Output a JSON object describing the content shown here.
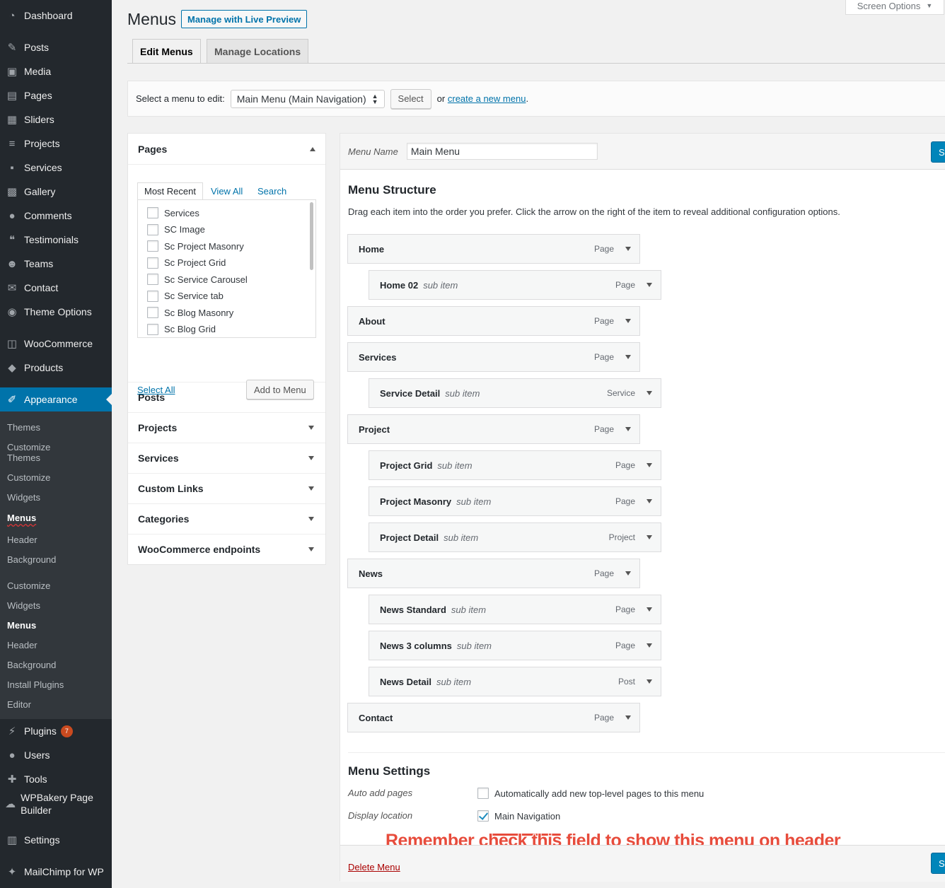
{
  "sidebar": {
    "items": [
      {
        "label": "Dashboard",
        "icon": "dashboard-icon"
      },
      {
        "label": "Posts",
        "icon": "pin-icon"
      },
      {
        "label": "Media",
        "icon": "media-icon"
      },
      {
        "label": "Pages",
        "icon": "pages-icon"
      },
      {
        "label": "Sliders",
        "icon": "sliders-icon"
      },
      {
        "label": "Projects",
        "icon": "projects-icon"
      },
      {
        "label": "Services",
        "icon": "grid-icon"
      },
      {
        "label": "Gallery",
        "icon": "gallery-icon"
      },
      {
        "label": "Comments",
        "icon": "comment-icon"
      },
      {
        "label": "Testimonials",
        "icon": "quote-icon"
      },
      {
        "label": "Teams",
        "icon": "groups-icon"
      },
      {
        "label": "Contact",
        "icon": "mail-icon"
      },
      {
        "label": "Theme Options",
        "icon": "theme-options-icon"
      },
      {
        "label": "WooCommerce",
        "icon": "woo-icon"
      },
      {
        "label": "Products",
        "icon": "box-icon"
      },
      {
        "label": "Appearance",
        "icon": "brush-icon"
      },
      {
        "label": "Plugins",
        "icon": "plugin-icon",
        "badge": "7"
      },
      {
        "label": "Users",
        "icon": "user-icon"
      },
      {
        "label": "Tools",
        "icon": "wrench-icon"
      },
      {
        "label": "WPBakery Page Builder",
        "icon": "wpbakery-icon"
      },
      {
        "label": "Settings",
        "icon": "settings-icon"
      },
      {
        "label": "MailChimp for WP",
        "icon": "mailchimp-icon"
      }
    ],
    "submenu": [
      "Themes",
      "Customize Themes",
      "Customize",
      "Widgets",
      "Menus",
      "Header",
      "Background",
      "Customize",
      "Widgets",
      "Menus",
      "Header",
      "Background",
      "Install Plugins",
      "Editor"
    ]
  },
  "header": {
    "title": "Menus",
    "live_preview": "Manage with Live Preview",
    "screen_options": "Screen Options",
    "tabs": [
      "Edit Menus",
      "Manage Locations"
    ]
  },
  "manage": {
    "label": "Select a menu to edit:",
    "selected": "Main Menu (Main Navigation)",
    "select_button": "Select",
    "or": "or",
    "create_link": "create a new menu",
    "period": "."
  },
  "left": {
    "pages_title": "Pages",
    "subtabs": [
      "Most Recent",
      "View All",
      "Search"
    ],
    "pages": [
      "Services",
      "SC Image",
      "Sc Project Masonry",
      "Sc Project Grid",
      "Sc Service Carousel",
      "Sc Service tab",
      "Sc Blog Masonry",
      "Sc Blog Grid"
    ],
    "select_all": "Select All",
    "add_to_menu": "Add to Menu",
    "sections": [
      "Posts",
      "Projects",
      "Services",
      "Custom Links",
      "Categories",
      "WooCommerce endpoints"
    ]
  },
  "right": {
    "menu_name_label": "Menu Name",
    "menu_name_value": "Main Menu",
    "save_label": "S",
    "structure_title": "Menu Structure",
    "structure_desc": "Drag each item into the order you prefer. Click the arrow on the right of the item to reveal additional configuration options.",
    "sub_item_label": "sub item",
    "items": [
      {
        "title": "Home",
        "type": "Page",
        "depth": 0
      },
      {
        "title": "Home 02",
        "type": "Page",
        "depth": 1
      },
      {
        "title": "About",
        "type": "Page",
        "depth": 0
      },
      {
        "title": "Services",
        "type": "Page",
        "depth": 0
      },
      {
        "title": "Service Detail",
        "type": "Service",
        "depth": 1
      },
      {
        "title": "Project",
        "type": "Page",
        "depth": 0
      },
      {
        "title": "Project Grid",
        "type": "Page",
        "depth": 1
      },
      {
        "title": "Project Masonry",
        "type": "Page",
        "depth": 1
      },
      {
        "title": "Project Detail",
        "type": "Project",
        "depth": 1
      },
      {
        "title": "News",
        "type": "Page",
        "depth": 0
      },
      {
        "title": "News Standard",
        "type": "Page",
        "depth": 1
      },
      {
        "title": "News 3 columns",
        "type": "Page",
        "depth": 1
      },
      {
        "title": "News Detail",
        "type": "Post",
        "depth": 1
      },
      {
        "title": "Contact",
        "type": "Page",
        "depth": 0
      }
    ],
    "settings_title": "Menu Settings",
    "auto_add_label": "Auto add pages",
    "auto_add_text": "Automatically add new top-level pages to this menu",
    "auto_add_checked": false,
    "display_location_label": "Display location",
    "location_text": "Main Navigation",
    "location_checked": true,
    "annotation": "Remember check this field to show this menu on header",
    "delete_menu": "Delete Menu"
  },
  "colors": {
    "accent": "#0073aa",
    "sidebar_bg": "#23282d",
    "annotation": "#e74c3c"
  }
}
